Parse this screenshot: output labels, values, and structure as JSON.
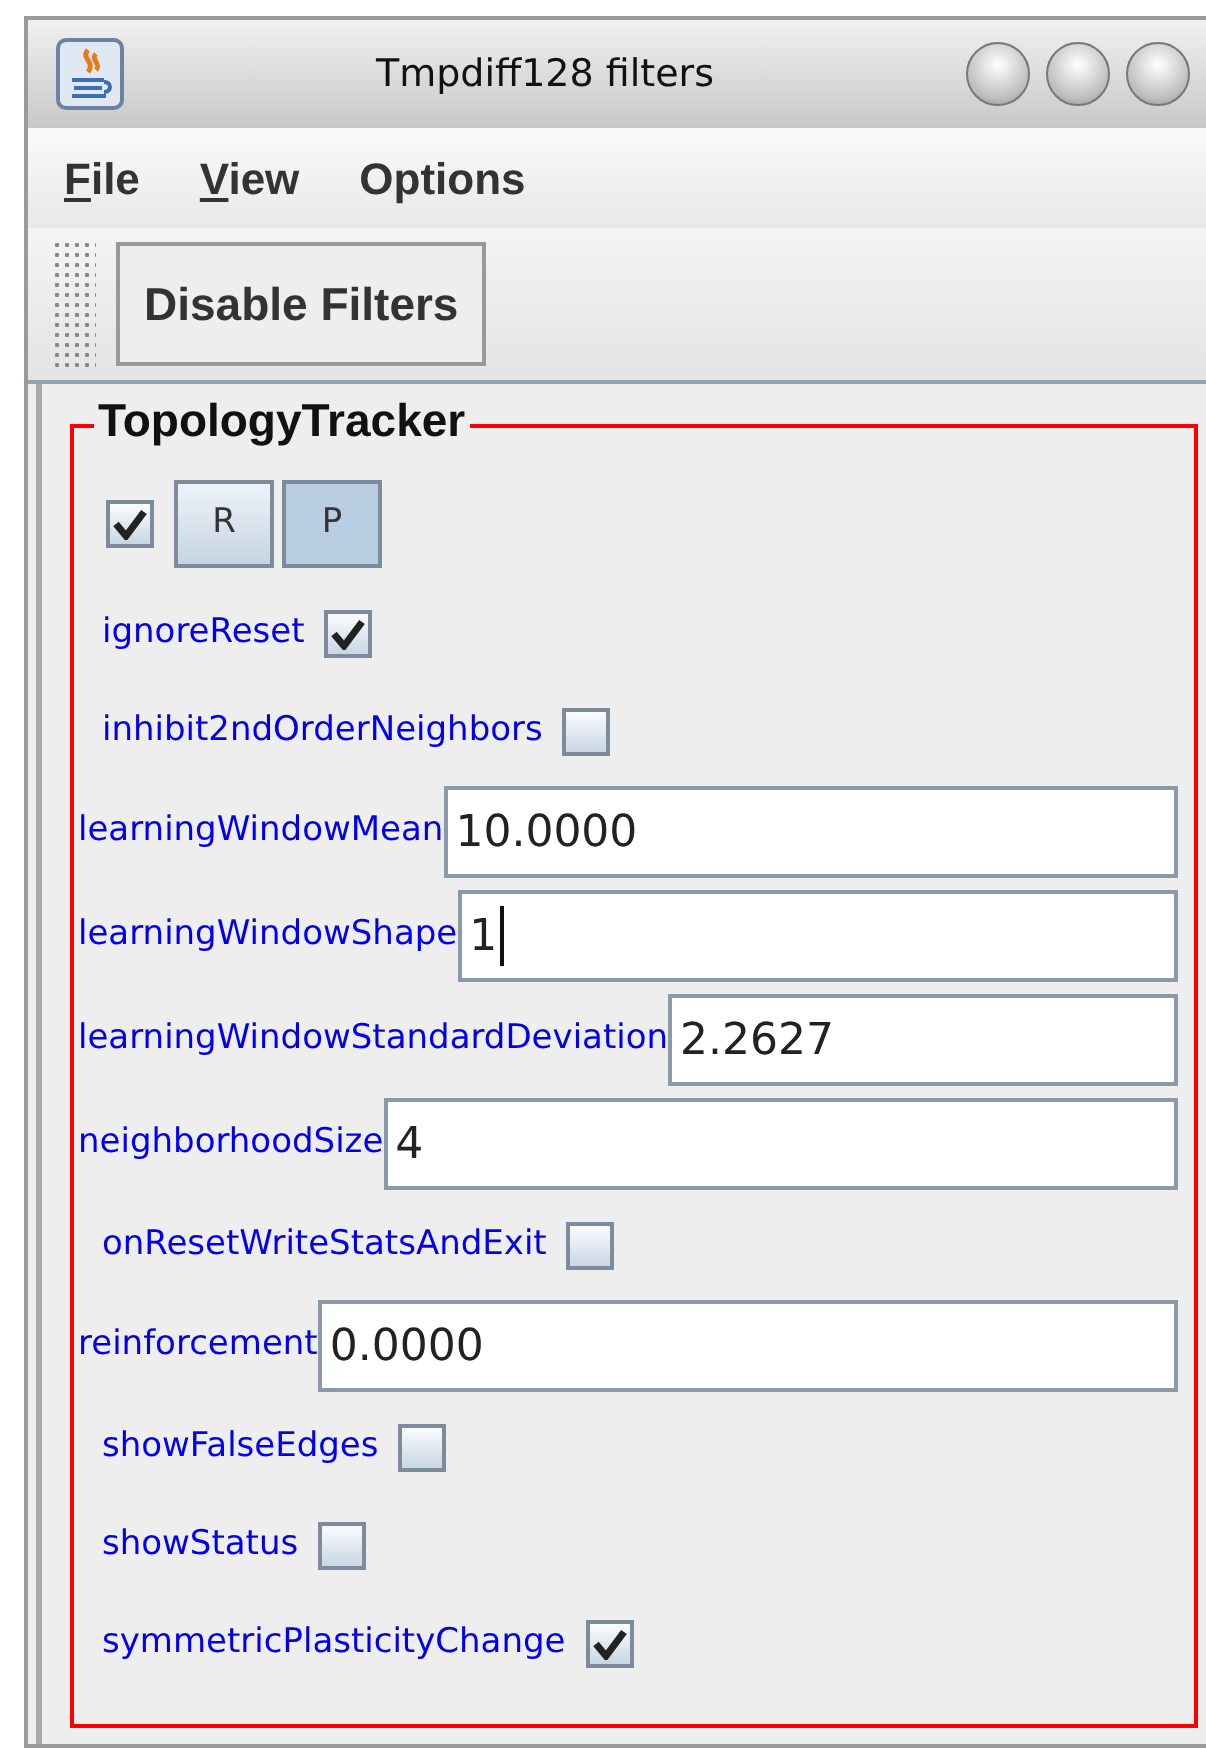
{
  "window": {
    "title": "Tmpdiff128 filters"
  },
  "menu": [
    {
      "label": "File",
      "first_letter_underlined": true
    },
    {
      "label": "View",
      "first_letter_underlined": true
    },
    {
      "label": "Options",
      "first_letter_underlined": false
    }
  ],
  "toolbar": {
    "button": "Disable Filters"
  },
  "filter": {
    "title": "TopologyTracker",
    "enabled": true,
    "buttons": [
      {
        "label": "R",
        "selected": false
      },
      {
        "label": "P",
        "selected": true
      }
    ],
    "properties": [
      {
        "kind": "checkbox",
        "label": "ignoreReset",
        "checked": true
      },
      {
        "kind": "checkbox",
        "label": "inhibit2ndOrderNeighbors",
        "checked": false
      },
      {
        "kind": "field",
        "label": "learningWindowMean",
        "value": "10.0000"
      },
      {
        "kind": "field",
        "label": "learningWindowShape",
        "value": "1",
        "focused": true
      },
      {
        "kind": "field",
        "label": "learningWindowStandardDeviation",
        "value": "2.2627"
      },
      {
        "kind": "field",
        "label": "neighborhoodSize",
        "value": "4"
      },
      {
        "kind": "checkbox",
        "label": "onResetWriteStatsAndExit",
        "checked": false
      },
      {
        "kind": "field",
        "label": "reinforcement",
        "value": "0.0000"
      },
      {
        "kind": "checkbox",
        "label": "showFalseEdges",
        "checked": false
      },
      {
        "kind": "checkbox",
        "label": "showStatus",
        "checked": false
      },
      {
        "kind": "checkbox",
        "label": "symmetricPlasticityChange",
        "checked": true
      }
    ]
  }
}
